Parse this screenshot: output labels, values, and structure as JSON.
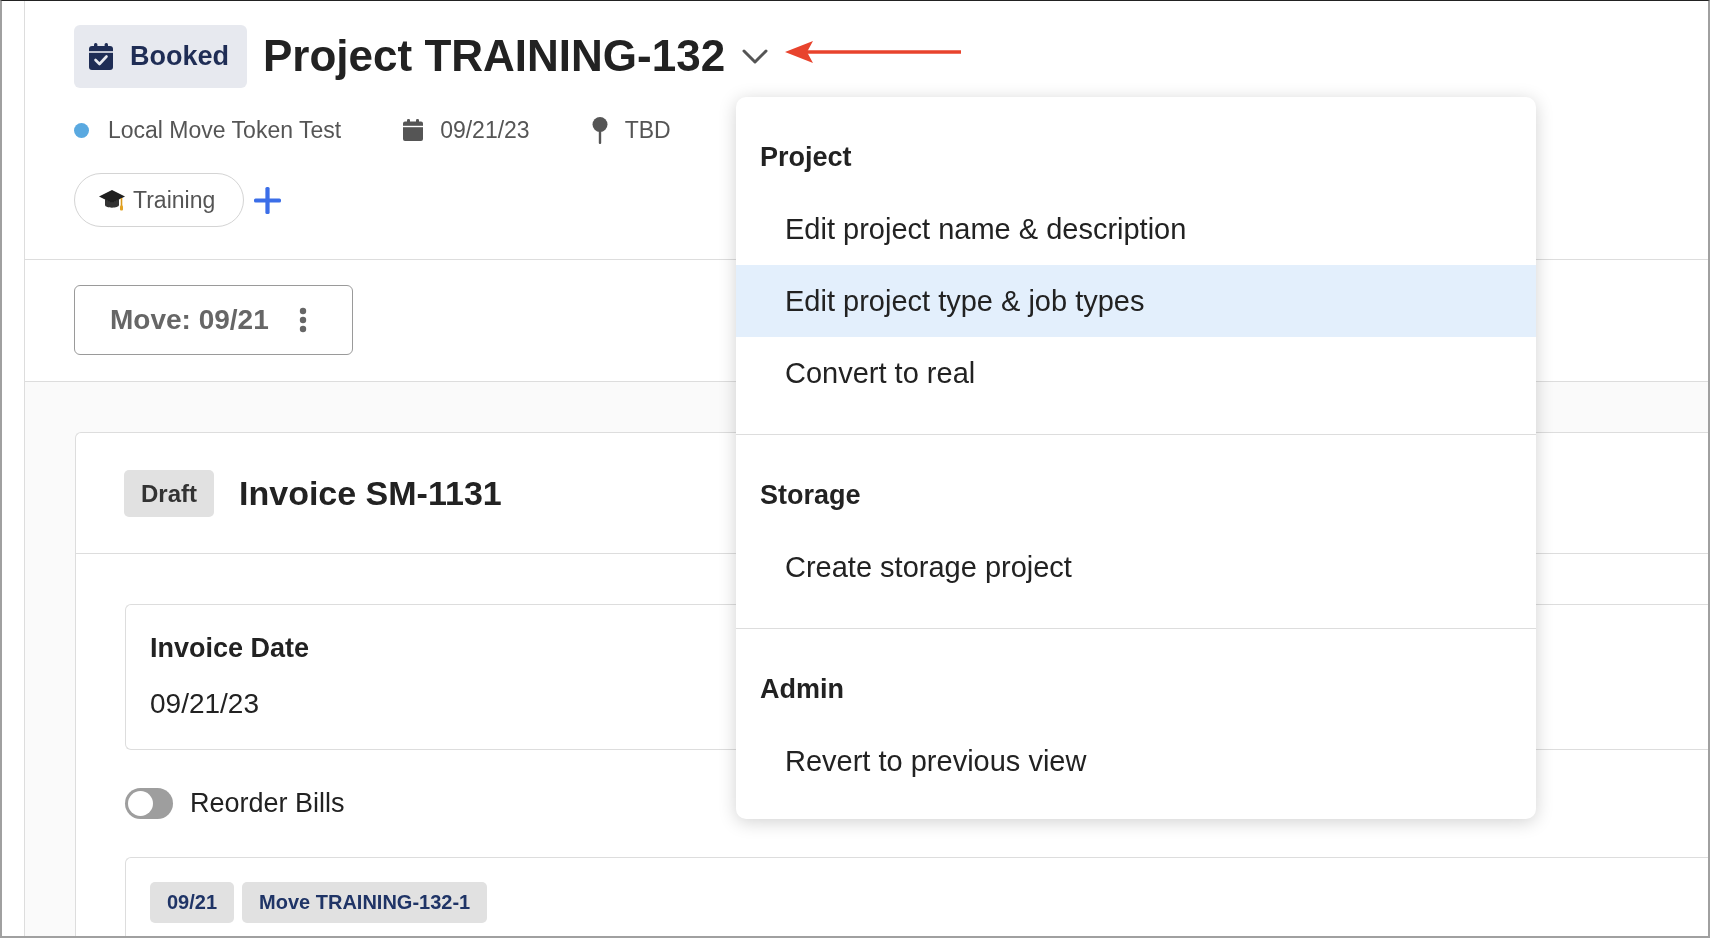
{
  "header": {
    "status": {
      "label": "Booked"
    },
    "title": "Project TRAINING-132",
    "meta": [
      {
        "kind": "type",
        "text": "Local Move Token Test",
        "color": "#5aa9e0"
      },
      {
        "kind": "date",
        "text": "09/21/23"
      },
      {
        "kind": "location",
        "text": "TBD"
      }
    ],
    "tags": [
      {
        "label": "Training"
      }
    ],
    "title_menu": {
      "expanded": true,
      "sections": [
        {
          "title": "Project",
          "items": [
            {
              "label": "Edit project name & description",
              "selected": false
            },
            {
              "label": "Edit project type & job types",
              "selected": true
            },
            {
              "label": "Convert to real",
              "selected": false
            }
          ]
        },
        {
          "title": "Storage",
          "items": [
            {
              "label": "Create storage project",
              "selected": false
            }
          ]
        },
        {
          "title": "Admin",
          "items": [
            {
              "label": "Revert to previous view",
              "selected": false
            }
          ]
        }
      ]
    }
  },
  "jobs": [
    {
      "label": "Move: 09/21"
    }
  ],
  "invoice": {
    "status": "Draft",
    "title": "Invoice SM-1131",
    "fields": [
      {
        "label": "Invoice Date",
        "value": "09/21/23"
      }
    ],
    "reorder_bills": {
      "label": "Reorder Bills",
      "on": false
    },
    "bills": [
      {
        "tags": [
          "09/21",
          "Move TRAINING-132-1"
        ]
      }
    ]
  }
}
